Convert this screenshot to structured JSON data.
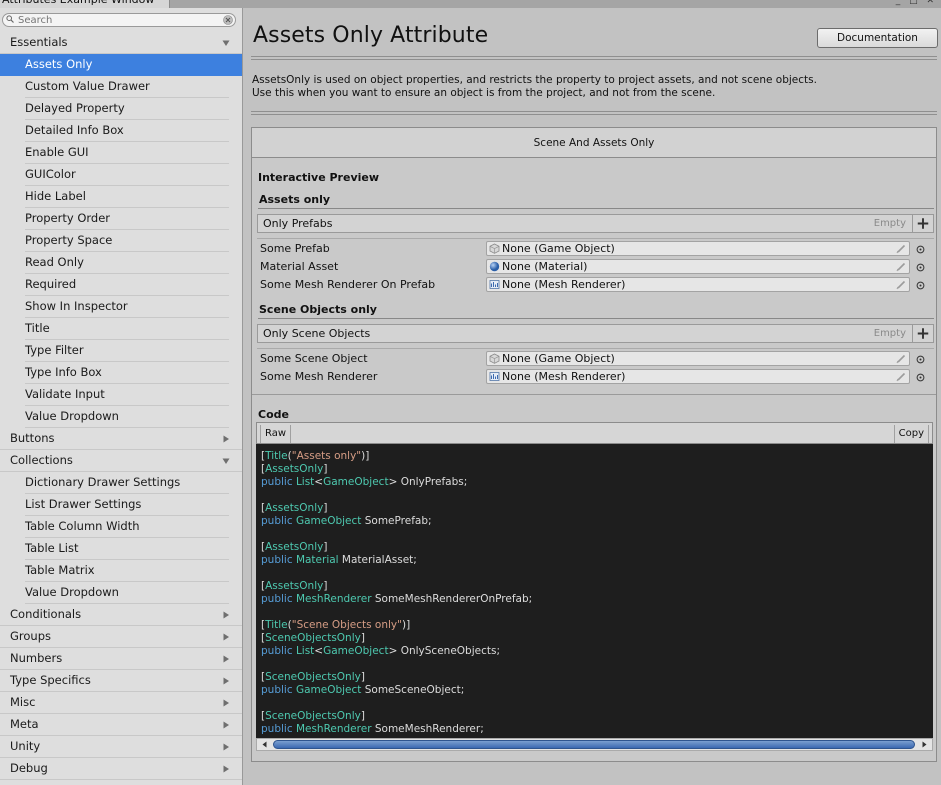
{
  "window": {
    "title": "Attributes Example Window"
  },
  "search": {
    "placeholder": "Search",
    "value": ""
  },
  "sidebar": {
    "items": [
      {
        "label": "Essentials",
        "kind": "group",
        "expanded": true
      },
      {
        "label": "Assets Only",
        "kind": "child",
        "selected": true
      },
      {
        "label": "Custom Value Drawer",
        "kind": "child"
      },
      {
        "label": "Delayed Property",
        "kind": "child"
      },
      {
        "label": "Detailed Info Box",
        "kind": "child"
      },
      {
        "label": "Enable GUI",
        "kind": "child"
      },
      {
        "label": "GUIColor",
        "kind": "child"
      },
      {
        "label": "Hide Label",
        "kind": "child"
      },
      {
        "label": "Property Order",
        "kind": "child"
      },
      {
        "label": "Property Space",
        "kind": "child"
      },
      {
        "label": "Read Only",
        "kind": "child"
      },
      {
        "label": "Required",
        "kind": "child"
      },
      {
        "label": "Show In Inspector",
        "kind": "child"
      },
      {
        "label": "Title",
        "kind": "child"
      },
      {
        "label": "Type Filter",
        "kind": "child"
      },
      {
        "label": "Type Info Box",
        "kind": "child"
      },
      {
        "label": "Validate Input",
        "kind": "child"
      },
      {
        "label": "Value Dropdown",
        "kind": "child"
      },
      {
        "label": "Buttons",
        "kind": "group",
        "expanded": false
      },
      {
        "label": "Collections",
        "kind": "group",
        "expanded": true
      },
      {
        "label": "Dictionary Drawer Settings",
        "kind": "child"
      },
      {
        "label": "List Drawer Settings",
        "kind": "child"
      },
      {
        "label": "Table Column Width",
        "kind": "child"
      },
      {
        "label": "Table List",
        "kind": "child"
      },
      {
        "label": "Table Matrix",
        "kind": "child"
      },
      {
        "label": "Value Dropdown",
        "kind": "child"
      },
      {
        "label": "Conditionals",
        "kind": "group",
        "expanded": false
      },
      {
        "label": "Groups",
        "kind": "group",
        "expanded": false
      },
      {
        "label": "Numbers",
        "kind": "group",
        "expanded": false
      },
      {
        "label": "Type Specifics",
        "kind": "group",
        "expanded": false
      },
      {
        "label": "Misc",
        "kind": "group",
        "expanded": false
      },
      {
        "label": "Meta",
        "kind": "group",
        "expanded": false
      },
      {
        "label": "Unity",
        "kind": "group",
        "expanded": false
      },
      {
        "label": "Debug",
        "kind": "group",
        "expanded": false
      }
    ]
  },
  "main": {
    "title": "Assets Only Attribute",
    "doc_button": "Documentation",
    "description": [
      "AssetsOnly is used on object properties, and restricts the property to project assets, and not scene objects.",
      "Use this when you want to ensure an object is from the project, and not from the scene."
    ],
    "panel_title": "Scene And Assets Only",
    "preview_label": "Interactive Preview",
    "assets_section": {
      "title": "Assets only",
      "list_label": "Only Prefabs",
      "list_empty": "Empty",
      "fields": [
        {
          "label": "Some Prefab",
          "value": "None (Game Object)",
          "icon": "gameobject-icon"
        },
        {
          "label": "Material Asset",
          "value": "None (Material)",
          "icon": "material-icon"
        },
        {
          "label": "Some Mesh Renderer On Prefab",
          "value": "None (Mesh Renderer)",
          "icon": "mesh-renderer-icon"
        }
      ]
    },
    "scene_section": {
      "title": "Scene Objects only",
      "list_label": "Only Scene Objects",
      "list_empty": "Empty",
      "fields": [
        {
          "label": "Some Scene Object",
          "value": "None (Game Object)",
          "icon": "gameobject-icon"
        },
        {
          "label": "Some Mesh Renderer",
          "value": "None (Mesh Renderer)",
          "icon": "mesh-renderer-icon"
        }
      ]
    },
    "code_label": "Code",
    "raw_tab": "Raw",
    "copy_button": "Copy",
    "code_lines": [
      [
        [
          "p",
          "["
        ],
        [
          "t",
          "Title"
        ],
        [
          "p",
          "("
        ],
        [
          "s",
          "\"Assets only\""
        ],
        [
          "p",
          ")]"
        ]
      ],
      [
        [
          "p",
          "["
        ],
        [
          "t",
          "AssetsOnly"
        ],
        [
          "p",
          "]"
        ]
      ],
      [
        [
          "k",
          "public "
        ],
        [
          "t",
          "List"
        ],
        [
          "p",
          "<"
        ],
        [
          "t",
          "GameObject"
        ],
        [
          "p",
          "> OnlyPrefabs;"
        ]
      ],
      [],
      [
        [
          "p",
          "["
        ],
        [
          "t",
          "AssetsOnly"
        ],
        [
          "p",
          "]"
        ]
      ],
      [
        [
          "k",
          "public "
        ],
        [
          "t",
          "GameObject"
        ],
        [
          "p",
          " SomePrefab;"
        ]
      ],
      [],
      [
        [
          "p",
          "["
        ],
        [
          "t",
          "AssetsOnly"
        ],
        [
          "p",
          "]"
        ]
      ],
      [
        [
          "k",
          "public "
        ],
        [
          "t",
          "Material"
        ],
        [
          "p",
          " MaterialAsset;"
        ]
      ],
      [],
      [
        [
          "p",
          "["
        ],
        [
          "t",
          "AssetsOnly"
        ],
        [
          "p",
          "]"
        ]
      ],
      [
        [
          "k",
          "public "
        ],
        [
          "t",
          "MeshRenderer"
        ],
        [
          "p",
          " SomeMeshRendererOnPrefab;"
        ]
      ],
      [],
      [
        [
          "p",
          "["
        ],
        [
          "t",
          "Title"
        ],
        [
          "p",
          "("
        ],
        [
          "s",
          "\"Scene Objects only\""
        ],
        [
          "p",
          ")]"
        ]
      ],
      [
        [
          "p",
          "["
        ],
        [
          "t",
          "SceneObjectsOnly"
        ],
        [
          "p",
          "]"
        ]
      ],
      [
        [
          "k",
          "public "
        ],
        [
          "t",
          "List"
        ],
        [
          "p",
          "<"
        ],
        [
          "t",
          "GameObject"
        ],
        [
          "p",
          "> OnlySceneObjects;"
        ]
      ],
      [],
      [
        [
          "p",
          "["
        ],
        [
          "t",
          "SceneObjectsOnly"
        ],
        [
          "p",
          "]"
        ]
      ],
      [
        [
          "k",
          "public "
        ],
        [
          "t",
          "GameObject"
        ],
        [
          "p",
          " SomeSceneObject;"
        ]
      ],
      [],
      [
        [
          "p",
          "["
        ],
        [
          "t",
          "SceneObjectsOnly"
        ],
        [
          "p",
          "]"
        ]
      ],
      [
        [
          "k",
          "public "
        ],
        [
          "t",
          "MeshRenderer"
        ],
        [
          "p",
          " SomeMeshRenderer;"
        ]
      ]
    ]
  },
  "colors": {
    "selection": "#3d80df",
    "keyword": "#569cd6",
    "type": "#4ec9b0",
    "string": "#d69d85",
    "code_bg": "#1e1e1e"
  }
}
